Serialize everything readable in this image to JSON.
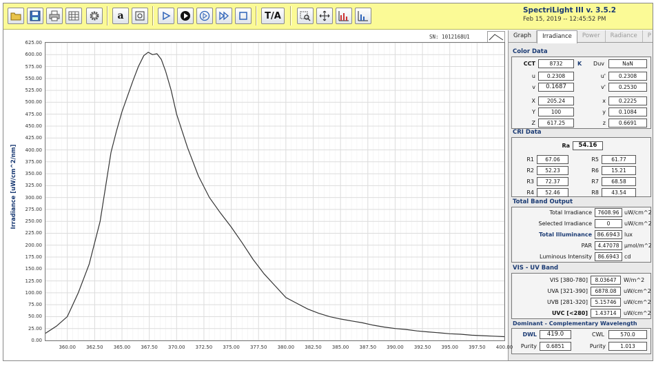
{
  "app": {
    "title": "SpectriLight III v. 3.5.2",
    "timestamp": "Feb 15, 2019 -- 12:45:52 PM"
  },
  "toolbar": {
    "text_a": "a",
    "ta_label": "T/A"
  },
  "chart": {
    "serial": "SN: 1012168U1",
    "ylabel": "Irradiance [uW/cm^2/nm]"
  },
  "chart_data": {
    "type": "line",
    "ylabel": "Irradiance [uW/cm^2/nm]",
    "xlim": [
      358.0,
      400.0
    ],
    "ylim": [
      0.0,
      625.0
    ],
    "grid": true,
    "ytick_labels": [
      "0.00",
      "25.00",
      "50.00",
      "75.00",
      "100.00",
      "125.00",
      "150.00",
      "175.00",
      "200.00",
      "225.00",
      "250.00",
      "275.00",
      "300.00",
      "325.00",
      "350.00",
      "375.00",
      "400.00",
      "425.00",
      "450.00",
      "475.00",
      "500.00",
      "525.00",
      "550.00",
      "575.00",
      "600.00",
      "625.00"
    ],
    "xtick_labels": [
      "360.00",
      "362.50",
      "365.00",
      "367.50",
      "370.00",
      "372.50",
      "375.00",
      "377.50",
      "380.00",
      "382.50",
      "385.00",
      "387.50",
      "390.00",
      "392.50",
      "395.00",
      "397.50",
      "400.00"
    ],
    "series": [
      {
        "x": [
          358.0,
          359.0,
          360.0,
          361.0,
          362.0,
          363.0,
          364.0,
          364.5,
          365.0,
          366.0,
          366.5,
          367.0,
          367.4,
          367.8,
          368.2,
          368.6,
          369.0,
          369.5,
          370.0,
          371.0,
          372.0,
          373.0,
          374.0,
          375.0,
          376.0,
          377.0,
          378.0,
          379.0,
          380.0,
          381.0,
          382.0,
          383.0,
          384.0,
          385.0,
          386.0,
          387.0,
          388.0,
          389.0,
          390.0,
          391.0,
          392.0,
          393.0,
          394.0,
          395.0,
          396.0,
          397.0,
          398.0,
          399.0,
          400.0
        ],
        "y": [
          15,
          30,
          50,
          100,
          160,
          250,
          395,
          440,
          480,
          545,
          575,
          598,
          605,
          600,
          602,
          590,
          565,
          525,
          475,
          405,
          345,
          300,
          268,
          238,
          205,
          170,
          140,
          115,
          90,
          78,
          66,
          57,
          50,
          45,
          41,
          37,
          32,
          28,
          25,
          23,
          20,
          18,
          16,
          14,
          13,
          11,
          10,
          9,
          8
        ]
      }
    ]
  },
  "tabs": [
    {
      "label": "Graph",
      "active": false
    },
    {
      "label": "Irradiance",
      "active": true
    },
    {
      "label": "Power",
      "active": false
    },
    {
      "label": "Radiance",
      "active": false
    },
    {
      "label": "P",
      "active": false
    }
  ],
  "color_data": {
    "title": "Color Data",
    "cct_label": "CCT",
    "cct": "8732",
    "cct_unit": "K",
    "duv_label": "Duv",
    "duv": "NaN",
    "u_label": "u",
    "u": "0.2308",
    "up_label": "u'",
    "up": "0.2308",
    "v_label": "v",
    "v": "0.1687",
    "vp_label": "v'",
    "vp": "0.2530",
    "X_label": "X",
    "X": "205.24",
    "Y_label": "Y",
    "Y": "100",
    "Z_label": "Z",
    "Z": "617.25",
    "x_label": "x",
    "x": "0.2225",
    "y_label": "y",
    "y": "0.1084",
    "z_label": "z",
    "z": "0.6691"
  },
  "cri_data": {
    "title": "CRI Data",
    "ra_label": "Ra",
    "ra": "54.16",
    "r": [
      {
        "label": "R1",
        "value": "67.06"
      },
      {
        "label": "R2",
        "value": "52.23"
      },
      {
        "label": "R3",
        "value": "72.37"
      },
      {
        "label": "R4",
        "value": "52.46"
      },
      {
        "label": "R5",
        "value": "61.77"
      },
      {
        "label": "R6",
        "value": "15.21"
      },
      {
        "label": "R7",
        "value": "68.58"
      },
      {
        "label": "R8",
        "value": "43.54"
      }
    ]
  },
  "band_output": {
    "title": "Total  Band Output",
    "rows": [
      {
        "label": "Total Irradiance",
        "value": "7608.96",
        "unit": "uW/cm^2"
      },
      {
        "label": "Selected Irradiance",
        "value": "0",
        "unit": "uW/cm^2"
      },
      {
        "label": "Total Illuminance",
        "value": "86.6943",
        "unit": "lux"
      },
      {
        "label": "PAR",
        "value": "4.47078",
        "unit": "µmol/m^2"
      },
      {
        "label": "Luminous Intensity",
        "value": "86.6943",
        "unit": "cd"
      }
    ]
  },
  "vis_uv": {
    "title": "VIS - UV Band",
    "rows": [
      {
        "label": "VIS [380-780]",
        "value": "8.03647",
        "unit": "W/m^2"
      },
      {
        "label": "UVA [321-390]",
        "value": "6878.08",
        "unit": "uW/cm^2"
      },
      {
        "label": "UVB [281-320]",
        "value": "5.15746",
        "unit": "uW/cm^2"
      },
      {
        "label": "UVC [<280]",
        "value": "1.43714",
        "unit": "uW/cm^2"
      }
    ]
  },
  "wavelength": {
    "title": "Dominant - Complementary Wavelength",
    "dwl_label": "DWL",
    "dwl": "419.0",
    "cwl_label": "CWL",
    "cwl": "570.0",
    "purity_label": "Purity",
    "purity_d": "0.6851",
    "purity_c_label": "Purity",
    "purity_c": "1.013"
  },
  "colors": {
    "toolbar_bg": "#fbfa96",
    "title_blue": "#1a3a73",
    "line": "#333333"
  }
}
